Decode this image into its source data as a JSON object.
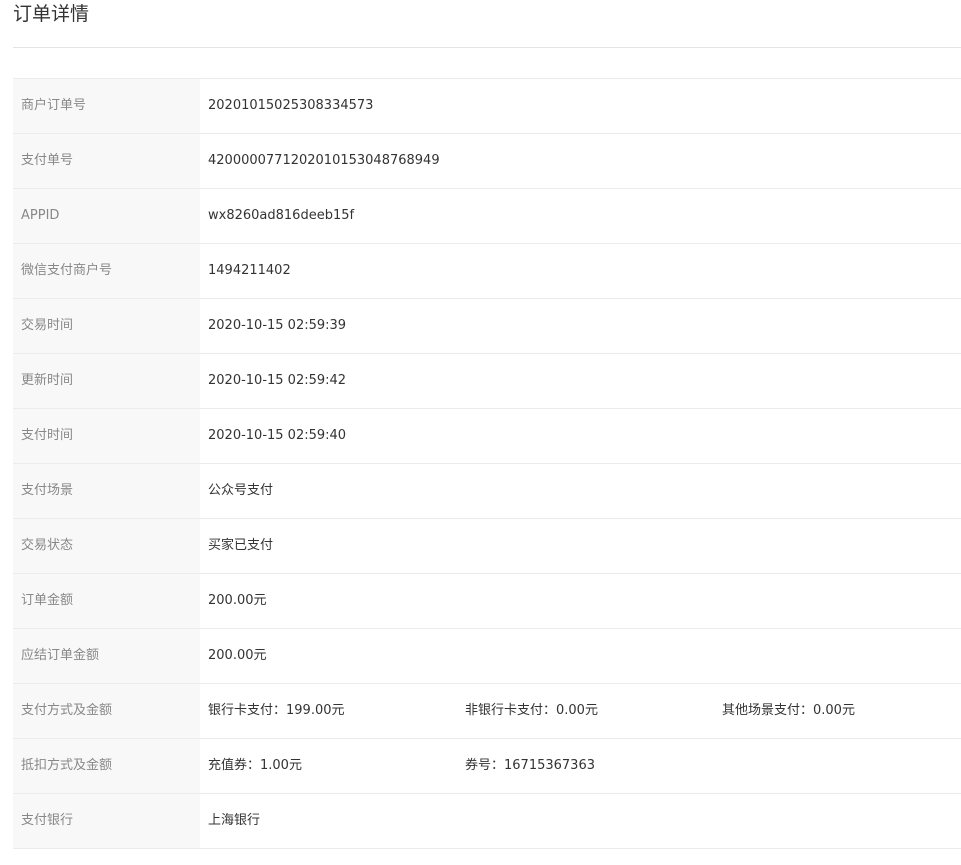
{
  "page": {
    "title": "订单详情"
  },
  "details": {
    "merchant_order_no": {
      "label": "商户订单号",
      "value": "20201015025308334573"
    },
    "pay_order_no": {
      "label": "支付单号",
      "value": "4200000771202010153048768949"
    },
    "appid": {
      "label": "APPID",
      "value": "wx8260ad816deeb15f"
    },
    "wechat_merchant_no": {
      "label": "微信支付商户号",
      "value": "1494211402"
    },
    "trade_time": {
      "label": "交易时间",
      "value": "2020-10-15 02:59:39"
    },
    "update_time": {
      "label": "更新时间",
      "value": "2020-10-15 02:59:42"
    },
    "pay_time": {
      "label": "支付时间",
      "value": "2020-10-15 02:59:40"
    },
    "pay_scene": {
      "label": "支付场景",
      "value": "公众号支付"
    },
    "trade_status": {
      "label": "交易状态",
      "value": "买家已支付"
    },
    "order_amount": {
      "label": "订单金额",
      "value": "200.00元"
    },
    "settle_amount": {
      "label": "应结订单金额",
      "value": "200.00元"
    },
    "pay_methods": {
      "label": "支付方式及金额",
      "bank_card": "银行卡支付：199.00元",
      "non_bank_card": "非银行卡支付：0.00元",
      "other_scene": "其他场景支付：0.00元"
    },
    "deduction": {
      "label": "抵扣方式及金额",
      "voucher": "充值券：1.00元",
      "coupon_no": "券号：16715367363"
    },
    "pay_bank": {
      "label": "支付银行",
      "value": "上海银行"
    }
  }
}
